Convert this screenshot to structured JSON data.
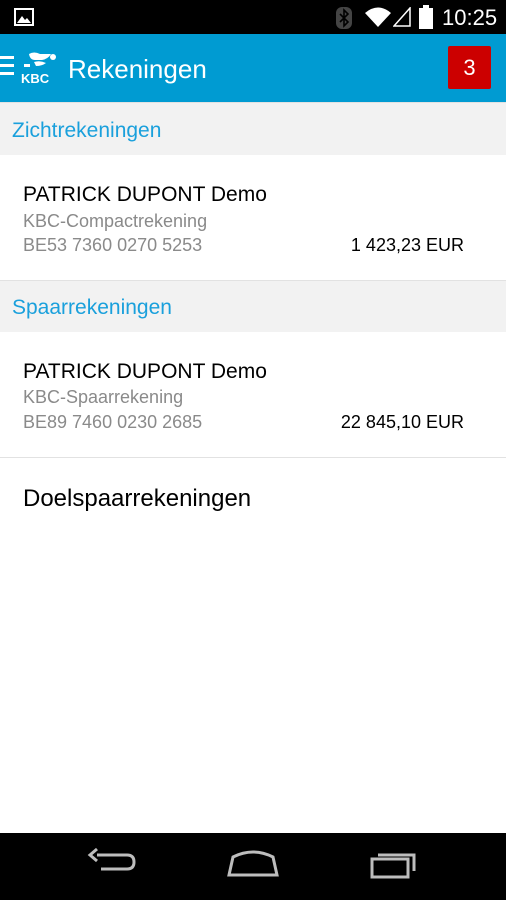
{
  "status_bar": {
    "time": "10:25"
  },
  "app_bar": {
    "title": "Rekeningen",
    "notification_count": "3"
  },
  "sections": [
    {
      "title": "Zichtrekeningen",
      "accounts": [
        {
          "holder": "PATRICK DUPONT Demo",
          "type": "KBC-Compactrekening",
          "iban": "BE53 7360 0270 5253",
          "balance": "1 423,23 EUR"
        }
      ]
    },
    {
      "title": "Spaarrekeningen",
      "accounts": [
        {
          "holder": "PATRICK DUPONT Demo",
          "type": "KBC-Spaarrekening",
          "iban": "BE89 7460 0230 2685",
          "balance": "22 845,10 EUR"
        }
      ]
    }
  ],
  "goal_savings": {
    "label": "Doelspaarrekeningen"
  },
  "colors": {
    "accent": "#009bd2",
    "section_title": "#1aa0dc",
    "badge": "#cc0000"
  },
  "icons": [
    "picture-icon",
    "bluetooth-icon",
    "wifi-icon",
    "signal-icon",
    "battery-icon",
    "menu-icon",
    "kbc-logo",
    "back-icon",
    "home-icon",
    "recent-apps-icon"
  ]
}
